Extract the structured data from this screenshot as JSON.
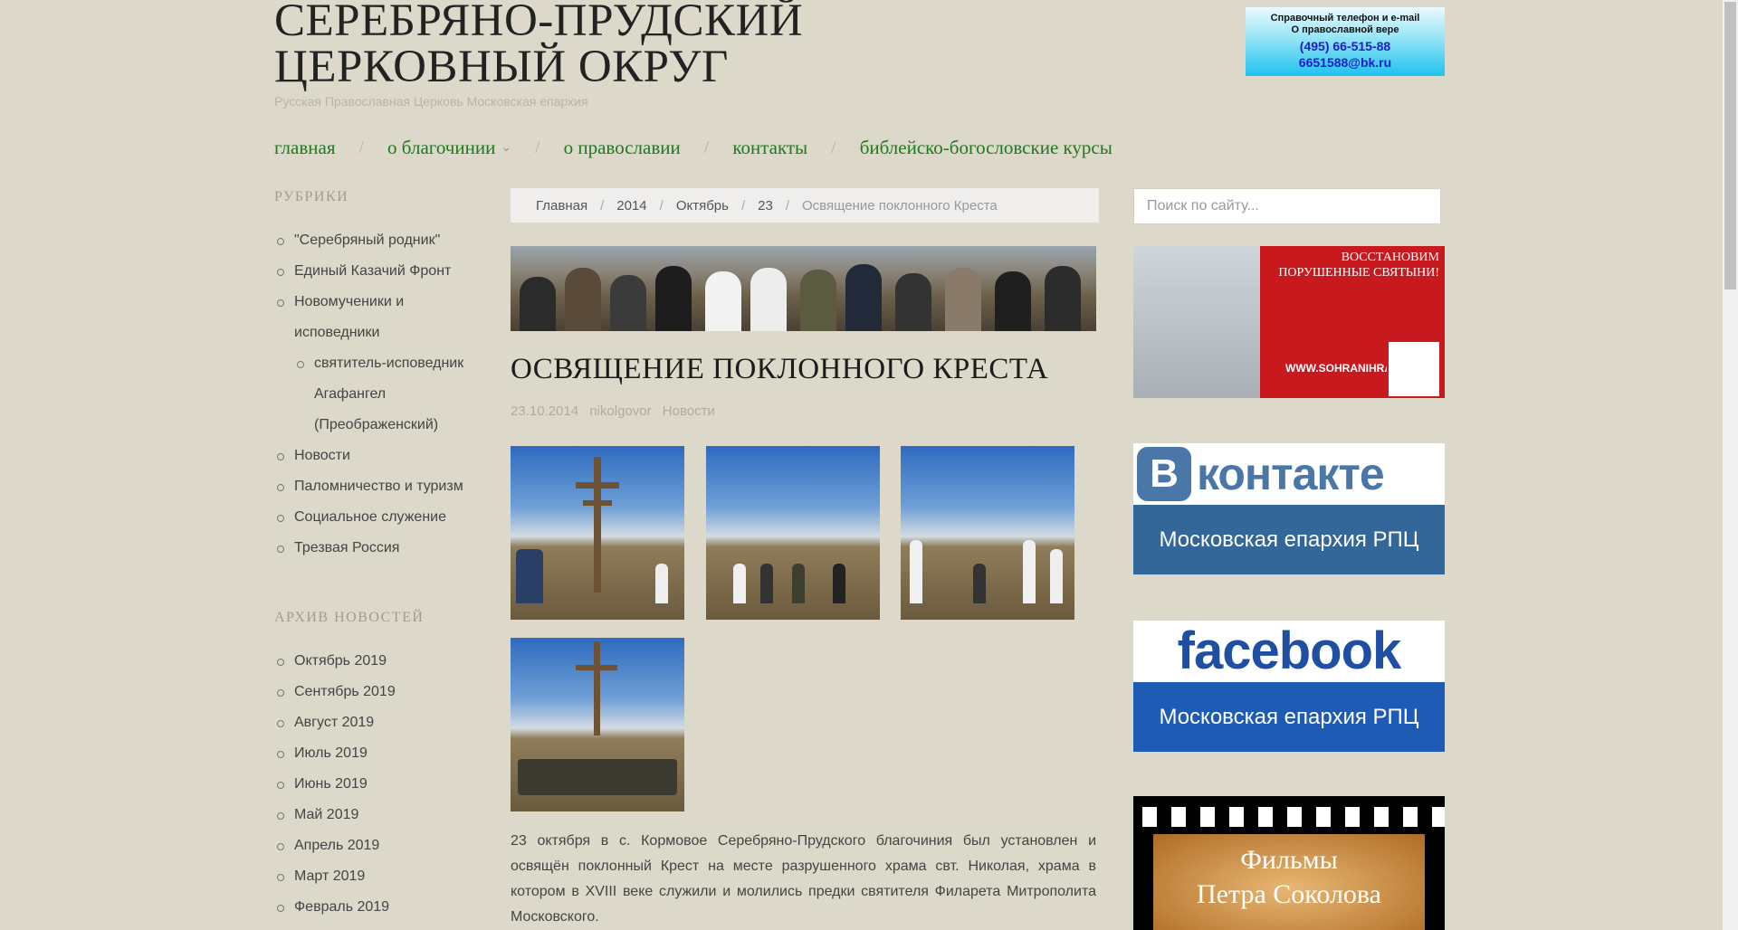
{
  "site": {
    "title_line1": "СЕРЕБРЯНО-ПРУДСКИЙ",
    "title_line2": "ЦЕРКОВНЫЙ ОКРУГ",
    "description": "Русская Православная Церковь Московская епархия"
  },
  "phone_banner": {
    "line1": "Справочный телефон и e-mail",
    "line2": "О православной вере",
    "phone": "(495) 66-515-88",
    "email": "6651588@bk.ru"
  },
  "nav": {
    "items": [
      {
        "label": "главная"
      },
      {
        "label": "о благочинии"
      },
      {
        "label": "о православии"
      },
      {
        "label": "контакты"
      },
      {
        "label": "библейско-богословские курсы"
      }
    ]
  },
  "sidebar": {
    "rubrics_title": "РУБРИКИ",
    "rubrics": [
      "\"Серебряный родник\"",
      "Единый Казачий Фронт",
      "Новомученики и исповедники",
      "святитель-исповедник Агафангел (Преображенский)",
      "Новости",
      "Паломничество и туризм",
      "Социальное служение",
      "Трезвая Россия"
    ],
    "archive_title": "АРХИВ НОВОСТЕЙ",
    "archive": [
      "Октябрь 2019",
      "Сентябрь 2019",
      "Август 2019",
      "Июль 2019",
      "Июнь 2019",
      "Май 2019",
      "Апрель 2019",
      "Март 2019",
      "Февраль 2019"
    ]
  },
  "breadcrumb": {
    "items": [
      "Главная",
      "2014",
      "Октябрь",
      "23"
    ],
    "current": "Освящение поклонного Креста",
    "separator": "/"
  },
  "post": {
    "title": "ОСВЯЩЕНИЕ ПОКЛОННОГО КРЕСТА",
    "date": "23.10.2014",
    "author": "nikolgovor",
    "category": "Новости",
    "body": "23 октября в с. Кормовое Серебряно-Прудского благочиния был установлен и освящён поклонный Крест на месте разрушенного храма свт. Николая, храма в котором в XVIII веке служили и молились предки святителя Филарета Митрополита Московского."
  },
  "right_sidebar": {
    "search_placeholder": "Поиск по сайту...",
    "ad1_text": "ВОССТАНОВИМ ПОРУШЕННЫЕ СВЯТЫНИ!",
    "ad1_url": "WWW.SOHRANIHRAM.RU",
    "vk_word": "контакте",
    "vk_letter": "B",
    "vk_caption": "Московская епархия РПЦ",
    "fb_word": "facebook",
    "fb_caption": "Московская епархия РПЦ",
    "film_line1": "Фильмы",
    "film_line2": "Петра Соколова"
  }
}
